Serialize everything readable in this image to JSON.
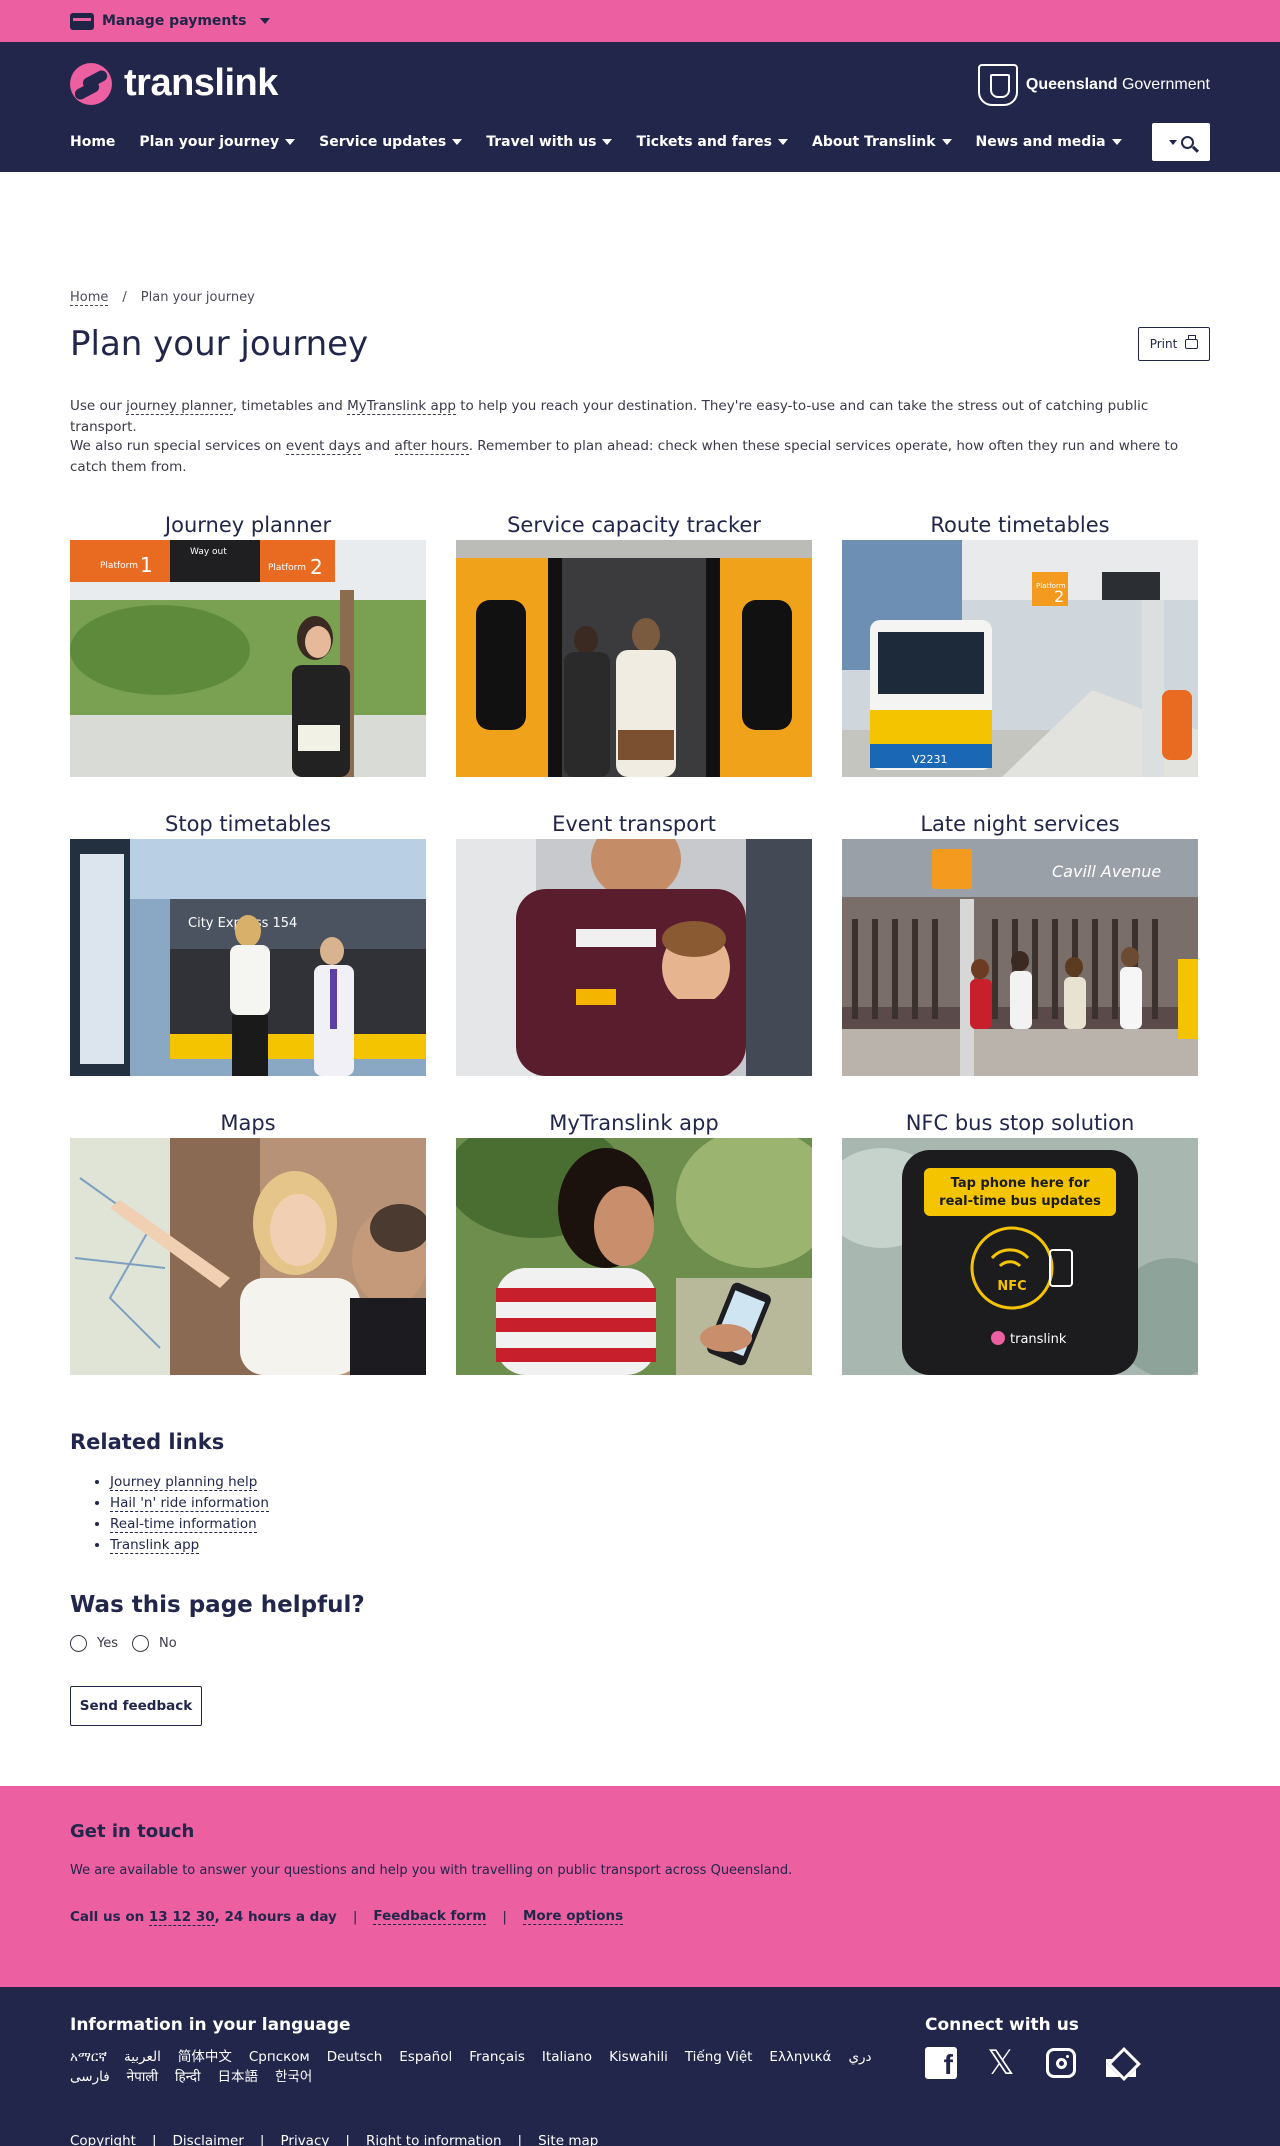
{
  "topbar": {
    "manage_payments": "Manage payments"
  },
  "header": {
    "logo_text": "translink",
    "qg_bold": "Queensland",
    "qg_rest": "Government",
    "nav": [
      {
        "label": "Home",
        "dropdown": false
      },
      {
        "label": "Plan your journey",
        "dropdown": true
      },
      {
        "label": "Service updates",
        "dropdown": true
      },
      {
        "label": "Travel with us",
        "dropdown": true
      },
      {
        "label": "Tickets and fares",
        "dropdown": true
      },
      {
        "label": "About Translink",
        "dropdown": true
      },
      {
        "label": "News and media",
        "dropdown": true
      }
    ]
  },
  "breadcrumb": {
    "home": "Home",
    "sep": "/",
    "current": "Plan your journey"
  },
  "page": {
    "title": "Plan your journey",
    "print": "Print",
    "intro1": {
      "a": "Use our ",
      "link1": "journey planner",
      "b": ", timetables and ",
      "link2": "MyTranslink app",
      "c": " to help you reach your destination. They're easy-to-use and can take the stress out of catching public transport."
    },
    "intro2": {
      "a": "We also run special services on ",
      "link1": "event days",
      "b": " and ",
      "link2": "after hours",
      "c": ". Remember to plan ahead: check when these special services operate, how often they run and where to catch them from."
    }
  },
  "tiles": [
    {
      "title": "Journey planner"
    },
    {
      "title": "Service capacity tracker"
    },
    {
      "title": "Route timetables"
    },
    {
      "title": "Stop timetables"
    },
    {
      "title": "Event transport"
    },
    {
      "title": "Late night services"
    },
    {
      "title": "Maps"
    },
    {
      "title": "MyTranslink app"
    },
    {
      "title": "NFC bus stop solution"
    }
  ],
  "tile_images": {
    "journey_platform1": "Platform",
    "journey_num1": "1",
    "journey_wayout": "Way out",
    "journey_platform2": "Platform",
    "journey_num2": "2",
    "route_platform": "Platform",
    "route_num": "2",
    "route_bus_num": "V2231",
    "stop_bus_sign": "City Express 154",
    "late_night_sign": "Cavill Avenue",
    "nfc_line1": "Tap phone here for",
    "nfc_line2": "real-time bus updates",
    "nfc_label": "NFC",
    "nfc_brand": "translink"
  },
  "related": {
    "heading": "Related links",
    "links": [
      "Journey planning help",
      "Hail 'n' ride information",
      "Real-time information",
      "Translink app"
    ]
  },
  "helpful": {
    "heading": "Was this page helpful?",
    "yes": "Yes",
    "no": "No",
    "send": "Send feedback"
  },
  "touch": {
    "heading": "Get in touch",
    "text": "We are available to answer your questions and help you with travelling on public transport across Queensland.",
    "call_prefix": "Call us on ",
    "phone": "13 12 30",
    "call_suffix": ", 24 hours a day",
    "feedback": "Feedback form",
    "more": "More options",
    "sep": "|"
  },
  "footer": {
    "lang_heading": "Information in your language",
    "languages": [
      "አማርኛ",
      "العربية",
      "简体中文",
      "Српском",
      "Deutsch",
      "Español",
      "Français",
      "Italiano",
      "Kiswahili",
      "Tiếng Việt",
      "Ελληνικά",
      "دري",
      "فارسی",
      "नेपाली",
      "हिन्दी",
      "日本語",
      "한국어"
    ],
    "connect_heading": "Connect with us",
    "links": [
      "Copyright",
      "|",
      "Disclaimer",
      "|",
      "Privacy",
      "|",
      "Right to information",
      "|",
      "Site map"
    ]
  },
  "colors": {
    "pink": "#ec5fa0",
    "navy": "#22264a"
  },
  "icons": [
    "card-icon",
    "chevron-down-icon",
    "search-icon",
    "printer-icon",
    "facebook-icon",
    "x-icon",
    "instagram-icon",
    "email-icon"
  ]
}
